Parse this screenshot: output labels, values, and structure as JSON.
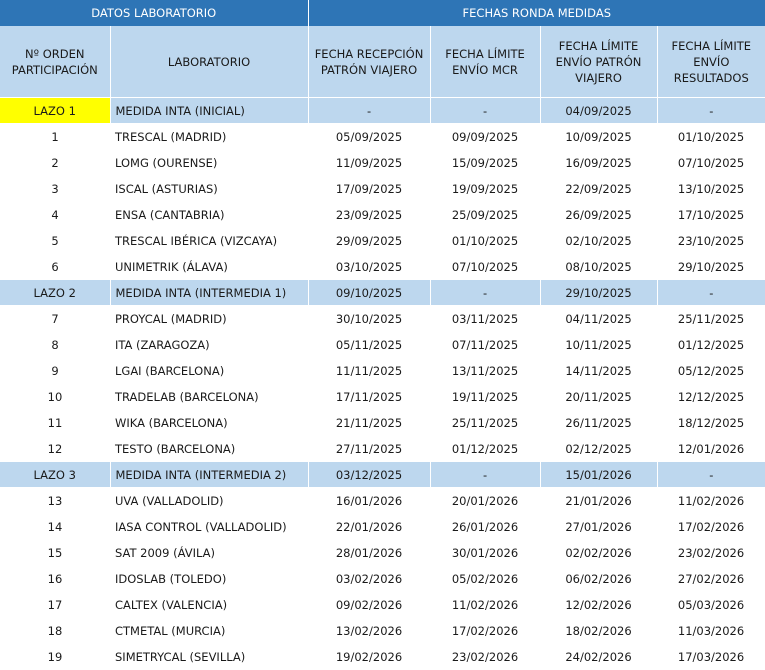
{
  "section_headers": {
    "lab_data": "DATOS LABORATORIO",
    "dates_round": "FECHAS RONDA MEDIDAS"
  },
  "columns": {
    "order": "Nº ORDEN PARTICIPACIÓN",
    "lab": "LABORATORIO",
    "reception": "FECHA RECEPCIÓN PATRÓN VIAJERO",
    "mcr": "FECHA LÍMITE ENVÍO MCR",
    "send_standard": "FECHA LÍMITE ENVÍO PATRÓN VIAJERO",
    "results": "FECHA LÍMITE ENVÍO RESULTADOS"
  },
  "colors": {
    "header_dark": "#2e75b6",
    "header_light": "#bdd7ee",
    "highlight": "#ffff00"
  },
  "rows": [
    {
      "order": "LAZO 1",
      "lab": "MEDIDA INTA (INICIAL)",
      "reception": "-",
      "mcr": "-",
      "send_standard": "04/09/2025",
      "results": "-"
    },
    {
      "order": "1",
      "lab": "TRESCAL (MADRID)",
      "reception": "05/09/2025",
      "mcr": "09/09/2025",
      "send_standard": "10/09/2025",
      "results": "01/10/2025"
    },
    {
      "order": "2",
      "lab": "LOMG (OURENSE)",
      "reception": "11/09/2025",
      "mcr": "15/09/2025",
      "send_standard": "16/09/2025",
      "results": "07/10/2025"
    },
    {
      "order": "3",
      "lab": "ISCAL (ASTURIAS)",
      "reception": "17/09/2025",
      "mcr": "19/09/2025",
      "send_standard": "22/09/2025",
      "results": "13/10/2025"
    },
    {
      "order": "4",
      "lab": "ENSA (CANTABRIA)",
      "reception": "23/09/2025",
      "mcr": "25/09/2025",
      "send_standard": "26/09/2025",
      "results": "17/10/2025"
    },
    {
      "order": "5",
      "lab": "TRESCAL IBÉRICA (VIZCAYA)",
      "reception": "29/09/2025",
      "mcr": "01/10/2025",
      "send_standard": "02/10/2025",
      "results": "23/10/2025"
    },
    {
      "order": "6",
      "lab": "UNIMETRIK (ÁLAVA)",
      "reception": "03/10/2025",
      "mcr": "07/10/2025",
      "send_standard": "08/10/2025",
      "results": "29/10/2025"
    },
    {
      "order": "LAZO 2",
      "lab": "MEDIDA INTA (INTERMEDIA 1)",
      "reception": "09/10/2025",
      "mcr": "-",
      "send_standard": "29/10/2025",
      "results": "-"
    },
    {
      "order": "7",
      "lab": "PROYCAL (MADRID)",
      "reception": "30/10/2025",
      "mcr": "03/11/2025",
      "send_standard": "04/11/2025",
      "results": "25/11/2025"
    },
    {
      "order": "8",
      "lab": "ITA (ZARAGOZA)",
      "reception": "05/11/2025",
      "mcr": "07/11/2025",
      "send_standard": "10/11/2025",
      "results": "01/12/2025"
    },
    {
      "order": "9",
      "lab": "LGAI (BARCELONA)",
      "reception": "11/11/2025",
      "mcr": "13/11/2025",
      "send_standard": "14/11/2025",
      "results": "05/12/2025"
    },
    {
      "order": "10",
      "lab": "TRADELAB (BARCELONA)",
      "reception": "17/11/2025",
      "mcr": "19/11/2025",
      "send_standard": "20/11/2025",
      "results": "12/12/2025"
    },
    {
      "order": "11",
      "lab": "WIKA (BARCELONA)",
      "reception": "21/11/2025",
      "mcr": "25/11/2025",
      "send_standard": "26/11/2025",
      "results": "18/12/2025"
    },
    {
      "order": "12",
      "lab": "TESTO (BARCELONA)",
      "reception": "27/11/2025",
      "mcr": "01/12/2025",
      "send_standard": "02/12/2025",
      "results": "12/01/2026"
    },
    {
      "order": "LAZO 3",
      "lab": "MEDIDA INTA (INTERMEDIA 2)",
      "reception": "03/12/2025",
      "mcr": "-",
      "send_standard": "15/01/2026",
      "results": "-"
    },
    {
      "order": "13",
      "lab": "UVA (VALLADOLID)",
      "reception": "16/01/2026",
      "mcr": "20/01/2026",
      "send_standard": "21/01/2026",
      "results": "11/02/2026"
    },
    {
      "order": "14",
      "lab": "IASA CONTROL (VALLADOLID)",
      "reception": "22/01/2026",
      "mcr": "26/01/2026",
      "send_standard": "27/01/2026",
      "results": "17/02/2026"
    },
    {
      "order": "15",
      "lab": "SAT 2009 (ÁVILA)",
      "reception": "28/01/2026",
      "mcr": "30/01/2026",
      "send_standard": "02/02/2026",
      "results": "23/02/2026"
    },
    {
      "order": "16",
      "lab": "IDOSLAB (TOLEDO)",
      "reception": "03/02/2026",
      "mcr": "05/02/2026",
      "send_standard": "06/02/2026",
      "results": "27/02/2026"
    },
    {
      "order": "17",
      "lab": "CALTEX (VALENCIA)",
      "reception": "09/02/2026",
      "mcr": "11/02/2026",
      "send_standard": "12/02/2026",
      "results": "05/03/2026"
    },
    {
      "order": "18",
      "lab": "CTMETAL (MURCIA)",
      "reception": "13/02/2026",
      "mcr": "17/02/2026",
      "send_standard": "18/02/2026",
      "results": "11/03/2026"
    },
    {
      "order": "19",
      "lab": "SIMETRYCAL (SEVILLA)",
      "reception": "19/02/2026",
      "mcr": "23/02/2026",
      "send_standard": "24/02/2026",
      "results": "17/03/2026"
    }
  ]
}
